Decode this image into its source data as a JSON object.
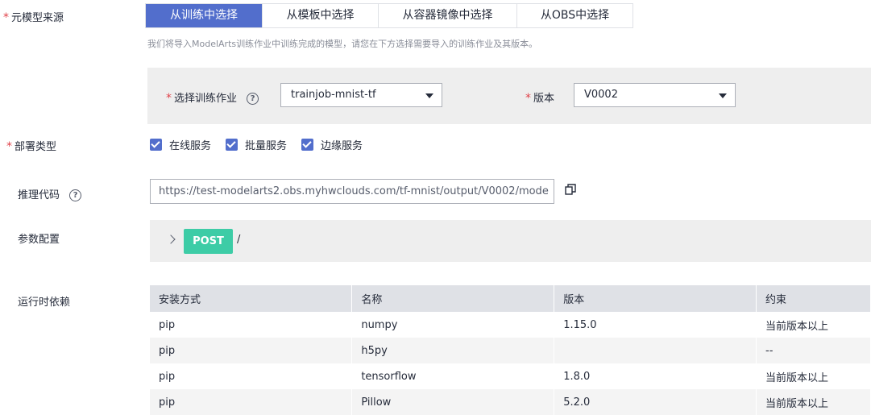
{
  "source": {
    "label": "元模型来源",
    "tabs": [
      "从训练中选择",
      "从模板中选择",
      "从容器镜像中选择",
      "从OBS中选择"
    ],
    "active_tab": 0,
    "hint": "我们将导入ModelArts训练作业中训练完成的模型，请您在下方选择需要导入的训练作业及其版本。"
  },
  "job": {
    "label": "选择训练作业",
    "value": "trainjob-mnist-tf",
    "version_label": "版本",
    "version_value": "V0002"
  },
  "deploy": {
    "label": "部署类型",
    "options": [
      "在线服务",
      "批量服务",
      "边缘服务"
    ]
  },
  "inference": {
    "label": "推理代码",
    "url": "https://test-modelarts2.obs.myhwclouds.com/tf-mnist/output/V0002/mode"
  },
  "params": {
    "label": "参数配置",
    "method": "POST",
    "path": "/"
  },
  "deps": {
    "label": "运行时依赖",
    "headers": [
      "安装方式",
      "名称",
      "版本",
      "约束"
    ],
    "rows": [
      [
        "pip",
        "numpy",
        "1.15.0",
        "当前版本以上"
      ],
      [
        "pip",
        "h5py",
        "",
        "--"
      ],
      [
        "pip",
        "tensorflow",
        "1.8.0",
        "当前版本以上"
      ],
      [
        "pip",
        "Pillow",
        "5.2.0",
        "当前版本以上"
      ]
    ]
  },
  "colors": {
    "primary": "#526ecc",
    "required": "#e0424a",
    "post": "#3dcca6"
  }
}
